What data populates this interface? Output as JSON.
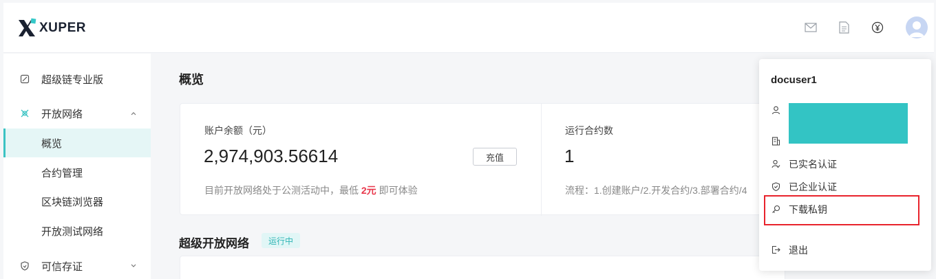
{
  "header": {
    "logo_text": "XUPER",
    "icons": [
      "mail-icon",
      "document-icon",
      "yuan-icon"
    ],
    "avatar": "user-avatar"
  },
  "sidebar": {
    "items": [
      {
        "label": "超级链专业版",
        "icon": "chain-pro-icon"
      },
      {
        "label": "开放网络",
        "icon": "network-icon",
        "expanded": true
      },
      {
        "label": "概览",
        "active": true
      },
      {
        "label": "合约管理"
      },
      {
        "label": "区块链浏览器"
      },
      {
        "label": "开放测试网络"
      },
      {
        "label": "可信存证",
        "icon": "shield-icon",
        "expanded": false
      }
    ]
  },
  "main": {
    "title": "概览",
    "balance": {
      "label": "账户余额（元）",
      "value": "2,974,903.56614",
      "recharge_label": "充值",
      "note_prefix": "目前开放网络处于公测活动中，最低",
      "note_highlight": "2元",
      "note_suffix": "即可体验"
    },
    "contracts": {
      "label": "运行合约数",
      "value": "1",
      "note": "流程：1.创建账户/2.开发合约/3.部署合约/4"
    },
    "section_title": "超级开放网络",
    "status_badge": "运行中"
  },
  "dropdown": {
    "username": "docuser1",
    "items": [
      {
        "label": "",
        "icon": "user-icon"
      },
      {
        "label": "",
        "icon": "company-icon"
      },
      {
        "label": "已实名认证",
        "icon": "verified-user-icon"
      },
      {
        "label": "已企业认证",
        "icon": "shield-check-icon"
      },
      {
        "label": "下载私钥",
        "icon": "key-icon"
      },
      {
        "label": "退出",
        "icon": "logout-icon"
      }
    ]
  },
  "colors": {
    "accent": "#3cc3c3",
    "highlight_red": "#e8364a",
    "redaction": "#33c4c4",
    "annotation_box": "#e8222b"
  }
}
